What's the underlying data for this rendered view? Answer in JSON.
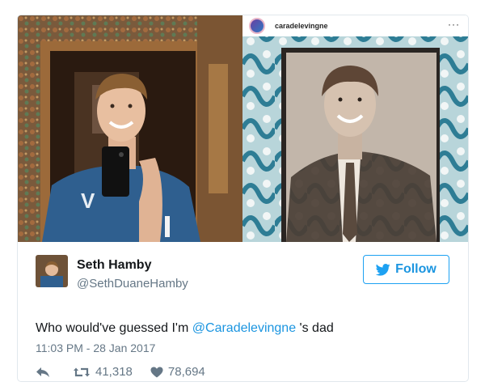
{
  "instagram": {
    "username": "caradelevingne",
    "more": "···"
  },
  "tweet": {
    "name": "Seth Hamby",
    "handle": "@SethDuaneHamby",
    "follow_label": "Follow",
    "text_before": "Who would've guessed I'm ",
    "mention": "@Caradelevingne",
    "text_after": " 's dad",
    "timestamp": "11:03 PM - 28 Jan 2017",
    "retweets": "41,318",
    "likes": "78,694"
  },
  "colors": {
    "accent": "#1da1f2",
    "link": "#1b95e0",
    "muted": "#657786",
    "text": "#14171a"
  },
  "icons": {
    "reply": "reply-icon",
    "retweet": "retweet-icon",
    "like": "heart-icon",
    "follow": "twitter-bird-icon"
  }
}
